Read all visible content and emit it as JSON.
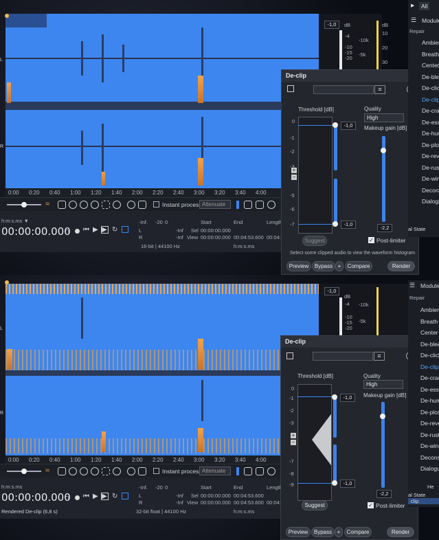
{
  "top": {
    "ruler_labels": [
      "0:00",
      "0:20",
      "0:40",
      "1:00",
      "1:20",
      "1:40",
      "2:00",
      "2:20",
      "2:40",
      "3:00",
      "3:20",
      "3:40",
      "4:00"
    ],
    "channel_labels": [
      "L",
      "R"
    ],
    "meter_value": "-1,0",
    "db_label": "dB",
    "db_scale": [
      "-4",
      "-10",
      "-15",
      "-20"
    ],
    "freq_labels": [
      "-10k",
      "-5k"
    ],
    "right_scale": [
      "dB",
      "10",
      "20",
      "30"
    ],
    "toolbar": {
      "instant_process_label": "Instant process",
      "attenuate_label": "Attenuate"
    },
    "transport": {
      "time_format": "h:m:s.ms ▼",
      "time": "00:00:00.000",
      "status": ""
    },
    "info": {
      "inf": "-Inf.",
      "minus20": "-20",
      "zero": "0",
      "L": "L",
      "R": "R",
      "inf_l": "-Inf",
      "inf_r": "-Inf",
      "format": "16-bit | 44100 Hz",
      "headers": {
        "start": "Start",
        "end": "End",
        "length": "Length"
      },
      "sel_label": "Sel",
      "view_label": "View",
      "sel_start": "00:00:00.000",
      "view_start": "00:00:00.000",
      "view_end": "00:04:53.600",
      "view_len": "00:04:5",
      "hms": "h:m:s.ms"
    },
    "plugin": {
      "title": "De-clip",
      "close": "×",
      "threshold_label": "Threshold [dB]",
      "quality_label": "Quality",
      "quality_value": "High",
      "makeup_label": "Makeup gain [dB]",
      "thresh_scale": [
        "0",
        "-1",
        "-2",
        "-3",
        "-4",
        "-5",
        "-6",
        "-7",
        "-8",
        "-9",
        "-10"
      ],
      "upper_thresh": "-1,0",
      "lower_thresh": "-1,0",
      "makeup_value": "-2,2",
      "post_limiter": "Post-limiter",
      "suggest": "Suggest",
      "hint": "Select some clipped audio to view the waveform histogram",
      "preview": "Preview",
      "bypass": "Bypass",
      "plus": "+",
      "compare": "Compare",
      "render": "Render",
      "help": "?"
    },
    "sidebar": {
      "all": "All",
      "modules": "Modules",
      "repair": "Repair",
      "items": [
        "Ambience",
        "Breath",
        "Center",
        "De-bleed",
        "De-click",
        "De-clip",
        "De-crackle",
        "De-ess",
        "De-hum",
        "De-plosive",
        "De-reverb",
        "De-rustle",
        "De-wind",
        "Deconstruct",
        "Dialogue"
      ],
      "state": "al State"
    }
  },
  "bottom": {
    "ruler_labels": [
      "0:00",
      "0:20",
      "0:40",
      "1:00",
      "1:20",
      "1:40",
      "2:00",
      "2:20",
      "2:40",
      "3:00",
      "3:20",
      "3:40",
      "4:00"
    ],
    "channel_labels": [
      "L",
      "R"
    ],
    "meter_value": "-1,0",
    "db_label": "dB",
    "db_scale": [
      "-4",
      "-10",
      "-15",
      "-20"
    ],
    "freq_labels": [
      "-10k",
      "-5k"
    ],
    "toolbar": {
      "instant_process_label": "Instant process",
      "attenuate_label": "Attenuate"
    },
    "transport": {
      "time_format": "h:m:s.ms",
      "time": "00:00:00.000",
      "status": "Rendered De-clip (6,8 s)"
    },
    "info": {
      "inf": "-Inf.",
      "minus20": "-20",
      "zero": "0",
      "L": "L",
      "R": "R",
      "inf_l": "-Inf",
      "inf_r": "-Inf",
      "format": "32-bit float | 44100 Hz",
      "headers": {
        "start": "Start",
        "end": "End",
        "length": "Length"
      },
      "sel_label": "Sel",
      "view_label": "View",
      "sel_start": "00:00:00.000",
      "sel_end": "00:04:53.600",
      "view_start": "00:00:00.000",
      "view_end": "00:04:53.600",
      "view_len": "00:04:5",
      "hms": "h:m:s.ms"
    },
    "plugin": {
      "title": "De-clip",
      "close": "×",
      "threshold_label": "Threshold [dB]",
      "quality_label": "Quality",
      "quality_value": "High",
      "makeup_label": "Makeup gain [dB]",
      "thresh_scale": [
        "0",
        "-1",
        "-2",
        "-3",
        "-4",
        "-5",
        "-6",
        "-7",
        "-8",
        "-9",
        "-10"
      ],
      "upper_thresh": "-1,0",
      "lower_thresh": "-1,0",
      "makeup_value": "-2,2",
      "post_limiter": "Post-limiter",
      "suggest": "Suggest",
      "preview": "Preview",
      "bypass": "Bypass",
      "plus": "+",
      "compare": "Compare",
      "render": "Render",
      "help": "?"
    },
    "sidebar": {
      "modules": "Module",
      "repair": "Repair",
      "items": [
        "Ambien",
        "Breath C",
        "Center E",
        "De-blee",
        "De-click",
        "De-clip",
        "De-crack",
        "De-ess",
        "De-hum",
        "De-plos",
        "De-reve",
        "De-rust",
        "De-wind",
        "Deconst",
        "Dialogue"
      ],
      "he": "He",
      "state": "al State",
      "clip": "clip"
    }
  }
}
